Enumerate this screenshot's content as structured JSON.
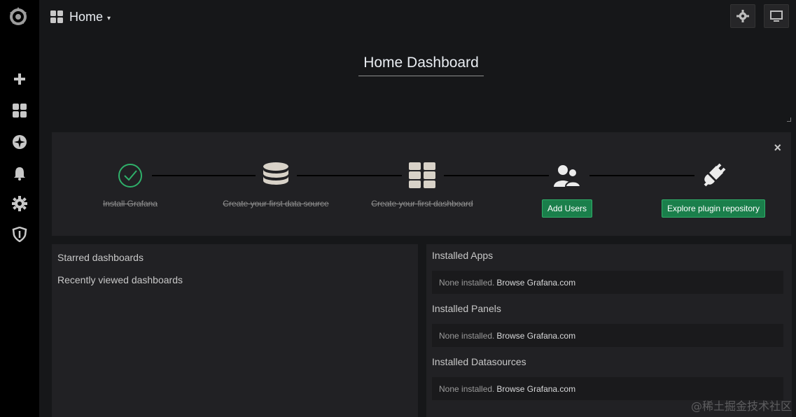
{
  "header": {
    "dashboard_name": "Home",
    "caret": "▾"
  },
  "dashboard": {
    "title": "Home Dashboard"
  },
  "sidebar": {
    "items": [
      "grafana-logo-icon",
      "plus-icon",
      "dashboards-icon",
      "compass-icon",
      "bell-icon",
      "gear-icon",
      "shield-icon"
    ]
  },
  "getting_started": {
    "close": "×",
    "steps": [
      {
        "label": "Install Grafana",
        "done": true,
        "icon": "check-circle-icon"
      },
      {
        "label": "Create your first data source",
        "done": true,
        "icon": "database-icon"
      },
      {
        "label": "Create your first dashboard",
        "done": true,
        "icon": "dashboard-grid-icon"
      },
      {
        "label": "Add Users",
        "done": false,
        "icon": "users-icon"
      },
      {
        "label": "Explore plugin repository",
        "done": false,
        "icon": "plug-icon"
      }
    ]
  },
  "left_panel": {
    "starred": "Starred dashboards",
    "recent": "Recently viewed dashboards"
  },
  "right_panel": {
    "sections": [
      {
        "heading": "Installed Apps",
        "none_text": "None installed.",
        "browse_text": "Browse Grafana.com"
      },
      {
        "heading": "Installed Panels",
        "none_text": "None installed.",
        "browse_text": "Browse Grafana.com"
      },
      {
        "heading": "Installed Datasources",
        "none_text": "None installed.",
        "browse_text": "Browse Grafana.com"
      }
    ]
  },
  "watermark": "@稀土掘金技术社区",
  "colors": {
    "accent_green": "#1a7f4b",
    "check_green": "#2fb06a",
    "background": "#161719",
    "panel": "#212124"
  }
}
